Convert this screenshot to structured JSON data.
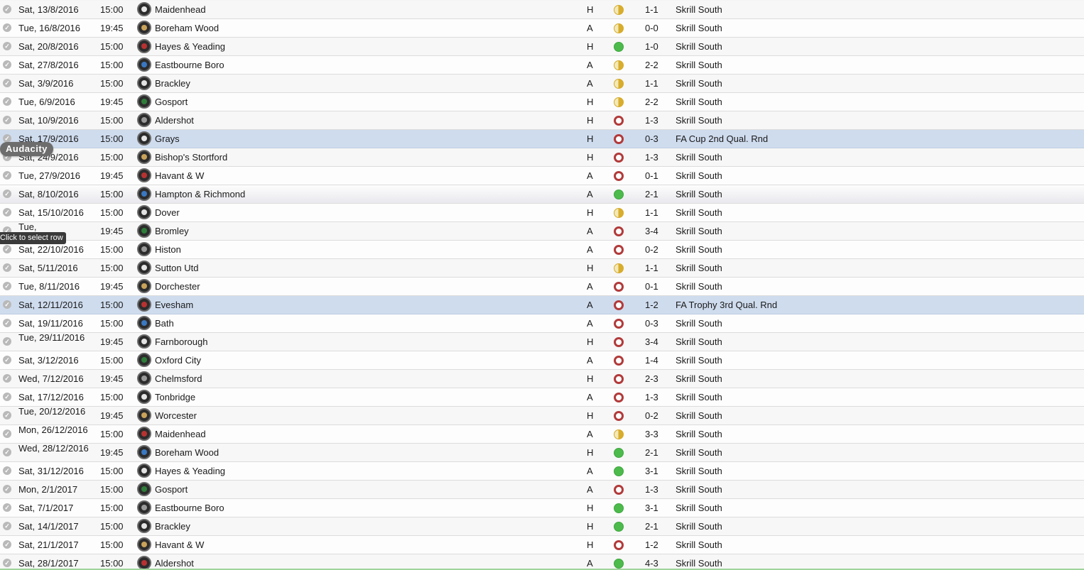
{
  "overlay": {
    "app_label": "Audacity",
    "tooltip": "Click to select row"
  },
  "colors": {
    "win": "#4cbb4c",
    "loss": "#b23a3a",
    "draw": "#d9ad2c",
    "highlight_row": "#cfdcee"
  },
  "fixtures": [
    {
      "date": "Sat, 13/8/2016",
      "time": "15:00",
      "opponent": "Maidenhead",
      "venue": "H",
      "result": "D",
      "score": "1-1",
      "competition": "Skrill South"
    },
    {
      "date": "Tue, 16/8/2016",
      "time": "19:45",
      "opponent": "Boreham Wood",
      "venue": "A",
      "result": "D",
      "score": "0-0",
      "competition": "Skrill South"
    },
    {
      "date": "Sat, 20/8/2016",
      "time": "15:00",
      "opponent": "Hayes & Yeading",
      "venue": "H",
      "result": "W",
      "score": "1-0",
      "competition": "Skrill South"
    },
    {
      "date": "Sat, 27/8/2016",
      "time": "15:00",
      "opponent": "Eastbourne Boro",
      "venue": "A",
      "result": "D",
      "score": "2-2",
      "competition": "Skrill South"
    },
    {
      "date": "Sat, 3/9/2016",
      "time": "15:00",
      "opponent": "Brackley",
      "venue": "A",
      "result": "D",
      "score": "1-1",
      "competition": "Skrill South"
    },
    {
      "date": "Tue, 6/9/2016",
      "time": "19:45",
      "opponent": "Gosport",
      "venue": "H",
      "result": "D",
      "score": "2-2",
      "competition": "Skrill South"
    },
    {
      "date": "Sat, 10/9/2016",
      "time": "15:00",
      "opponent": "Aldershot",
      "venue": "H",
      "result": "L",
      "score": "1-3",
      "competition": "Skrill South"
    },
    {
      "date": "Sat, 17/9/2016",
      "time": "15:00",
      "opponent": "Grays",
      "venue": "H",
      "result": "L",
      "score": "0-3",
      "competition": "FA Cup 2nd Qual. Rnd",
      "highlight": true
    },
    {
      "date": "Sat, 24/9/2016",
      "time": "15:00",
      "opponent": "Bishop's Stortford",
      "venue": "H",
      "result": "L",
      "score": "1-3",
      "competition": "Skrill South"
    },
    {
      "date": "Tue, 27/9/2016",
      "time": "19:45",
      "opponent": "Havant & W",
      "venue": "A",
      "result": "L",
      "score": "0-1",
      "competition": "Skrill South"
    },
    {
      "date": "Sat, 8/10/2016",
      "time": "15:00",
      "opponent": "Hampton & Richmond",
      "venue": "A",
      "result": "W",
      "score": "2-1",
      "competition": "Skrill South",
      "hover": true
    },
    {
      "date": "Sat, 15/10/2016",
      "time": "15:00",
      "opponent": "Dover",
      "venue": "H",
      "result": "D",
      "score": "1-1",
      "competition": "Skrill South"
    },
    {
      "date": "Tue,",
      "time": "19:45",
      "opponent": "Bromley",
      "venue": "A",
      "result": "L",
      "score": "3-4",
      "competition": "Skrill South",
      "wrapped": true
    },
    {
      "date": "Sat, 22/10/2016",
      "time": "15:00",
      "opponent": "Histon",
      "venue": "A",
      "result": "L",
      "score": "0-2",
      "competition": "Skrill South"
    },
    {
      "date": "Sat, 5/11/2016",
      "time": "15:00",
      "opponent": "Sutton Utd",
      "venue": "H",
      "result": "D",
      "score": "1-1",
      "competition": "Skrill South"
    },
    {
      "date": "Tue, 8/11/2016",
      "time": "19:45",
      "opponent": "Dorchester",
      "venue": "A",
      "result": "L",
      "score": "0-1",
      "competition": "Skrill South"
    },
    {
      "date": "Sat, 12/11/2016",
      "time": "15:00",
      "opponent": "Evesham",
      "venue": "A",
      "result": "L",
      "score": "1-2",
      "competition": "FA Trophy 3rd Qual. Rnd",
      "highlight": true
    },
    {
      "date": "Sat, 19/11/2016",
      "time": "15:00",
      "opponent": "Bath",
      "venue": "A",
      "result": "L",
      "score": "0-3",
      "competition": "Skrill South"
    },
    {
      "date": "Tue, 29/11/2016",
      "time": "19:45",
      "opponent": "Farnborough",
      "venue": "H",
      "result": "L",
      "score": "3-4",
      "competition": "Skrill South",
      "wrapped": true
    },
    {
      "date": "Sat, 3/12/2016",
      "time": "15:00",
      "opponent": "Oxford City",
      "venue": "A",
      "result": "L",
      "score": "1-4",
      "competition": "Skrill South"
    },
    {
      "date": "Wed, 7/12/2016",
      "time": "19:45",
      "opponent": "Chelmsford",
      "venue": "H",
      "result": "L",
      "score": "2-3",
      "competition": "Skrill South"
    },
    {
      "date": "Sat, 17/12/2016",
      "time": "15:00",
      "opponent": "Tonbridge",
      "venue": "A",
      "result": "L",
      "score": "1-3",
      "competition": "Skrill South"
    },
    {
      "date": "Tue, 20/12/2016",
      "time": "19:45",
      "opponent": "Worcester",
      "venue": "H",
      "result": "L",
      "score": "0-2",
      "competition": "Skrill South",
      "wrapped": true
    },
    {
      "date": "Mon, 26/12/2016",
      "time": "15:00",
      "opponent": "Maidenhead",
      "venue": "A",
      "result": "D",
      "score": "3-3",
      "competition": "Skrill South",
      "wrapped": true
    },
    {
      "date": "Wed, 28/12/2016",
      "time": "19:45",
      "opponent": "Boreham Wood",
      "venue": "H",
      "result": "W",
      "score": "2-1",
      "competition": "Skrill South",
      "wrapped": true
    },
    {
      "date": "Sat, 31/12/2016",
      "time": "15:00",
      "opponent": "Hayes & Yeading",
      "venue": "A",
      "result": "W",
      "score": "3-1",
      "competition": "Skrill South"
    },
    {
      "date": "Mon, 2/1/2017",
      "time": "15:00",
      "opponent": "Gosport",
      "venue": "A",
      "result": "L",
      "score": "1-3",
      "competition": "Skrill South"
    },
    {
      "date": "Sat, 7/1/2017",
      "time": "15:00",
      "opponent": "Eastbourne Boro",
      "venue": "H",
      "result": "W",
      "score": "3-1",
      "competition": "Skrill South"
    },
    {
      "date": "Sat, 14/1/2017",
      "time": "15:00",
      "opponent": "Brackley",
      "venue": "H",
      "result": "W",
      "score": "2-1",
      "competition": "Skrill South"
    },
    {
      "date": "Sat, 21/1/2017",
      "time": "15:00",
      "opponent": "Havant & W",
      "venue": "H",
      "result": "L",
      "score": "1-2",
      "competition": "Skrill South"
    },
    {
      "date": "Sat, 28/1/2017",
      "time": "15:00",
      "opponent": "Aldershot",
      "venue": "A",
      "result": "W",
      "score": "4-3",
      "competition": "Skrill South"
    }
  ]
}
